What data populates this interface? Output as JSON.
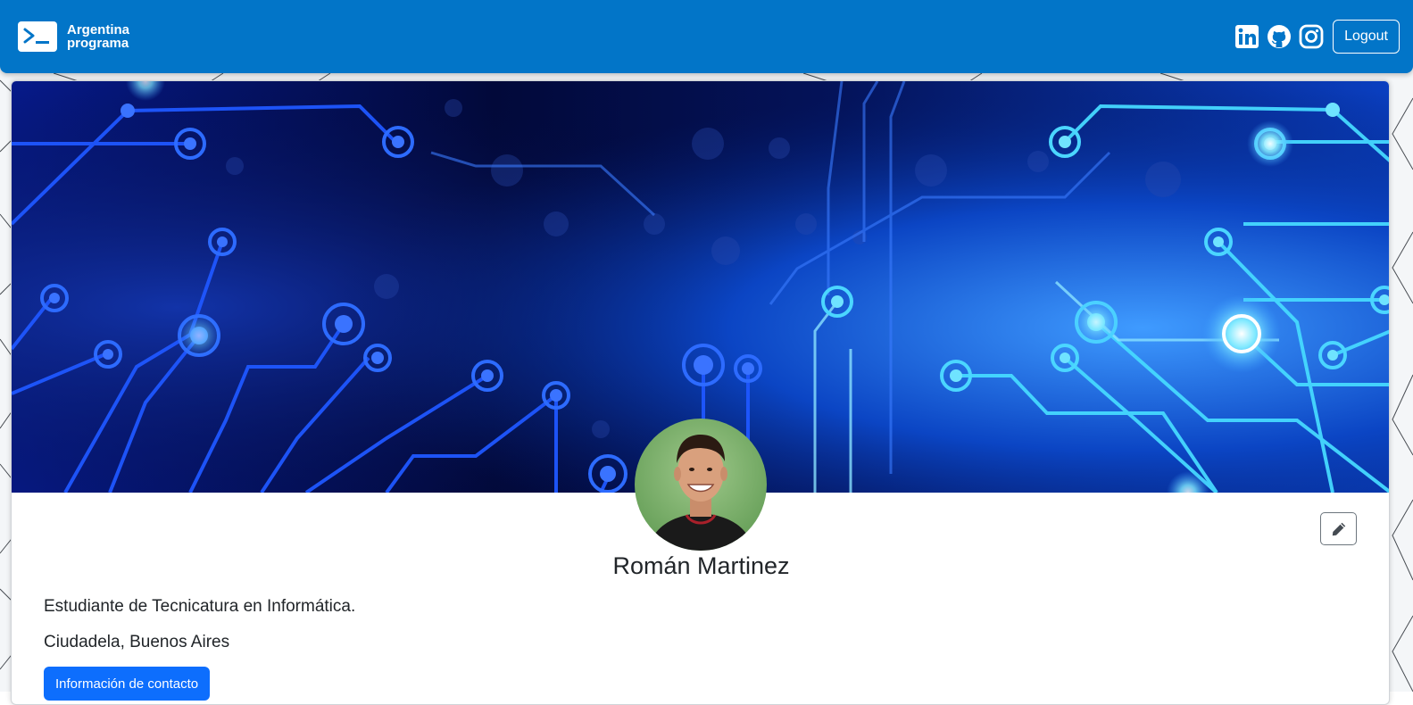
{
  "brand": {
    "line1": "Argentina",
    "line2": "programa",
    "logo_icon": "terminal-prompt-icon"
  },
  "nav": {
    "social": [
      {
        "name": "linkedin-icon"
      },
      {
        "name": "github-icon"
      },
      {
        "name": "instagram-icon"
      }
    ],
    "logout_label": "Logout"
  },
  "profile": {
    "name": "Román Martinez",
    "description": "Estudiante de Tecnicatura en Informática.",
    "location": "Ciudadela, Buenos Aires",
    "contact_button": "Información de contacto",
    "edit_icon": "pencil-icon"
  },
  "colors": {
    "navbar": "#0275c8",
    "primary_button": "#0d6efd",
    "banner_dark": "#02093a",
    "banner_light": "#2b7bf0"
  }
}
